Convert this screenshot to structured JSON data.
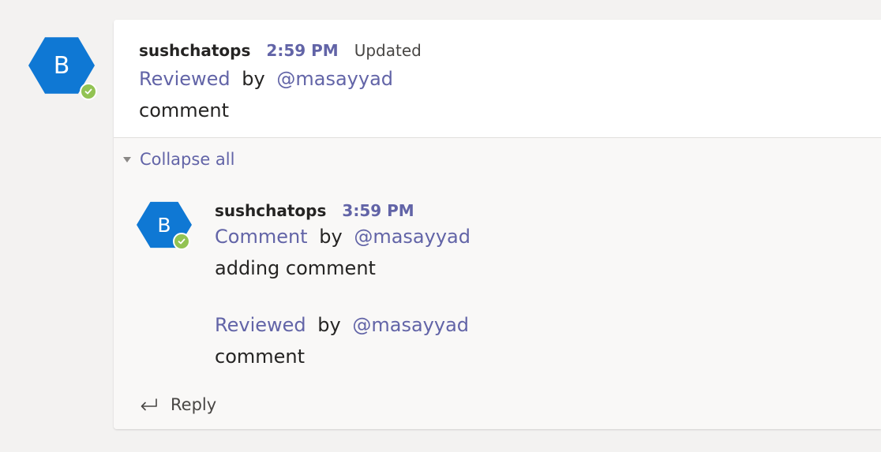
{
  "main_message": {
    "avatar_initial": "B",
    "sender": "sushchatops",
    "time": "2:59 PM",
    "updated_label": "Updated",
    "action_link": "Reviewed",
    "by_word": "by",
    "mention": "@masayyad",
    "body": "comment"
  },
  "thread": {
    "collapse_label": "Collapse all",
    "reply": {
      "avatar_initial": "B",
      "sender": "sushchatops",
      "time": "3:59 PM",
      "entries": [
        {
          "action_link": "Comment",
          "by_word": "by",
          "mention": "@masayyad",
          "body": "adding comment"
        },
        {
          "action_link": "Reviewed",
          "by_word": "by",
          "mention": "@masayyad",
          "body": "comment"
        }
      ]
    },
    "reply_label": "Reply"
  },
  "colors": {
    "accent": "#6264a7",
    "avatar_bg": "#0f78d4",
    "presence_available": "#92c353",
    "page_bg": "#f3f2f1"
  },
  "icons": {
    "presence": "checkmark-icon",
    "collapse": "triangle-down-icon",
    "reply": "reply-arrow-icon"
  }
}
